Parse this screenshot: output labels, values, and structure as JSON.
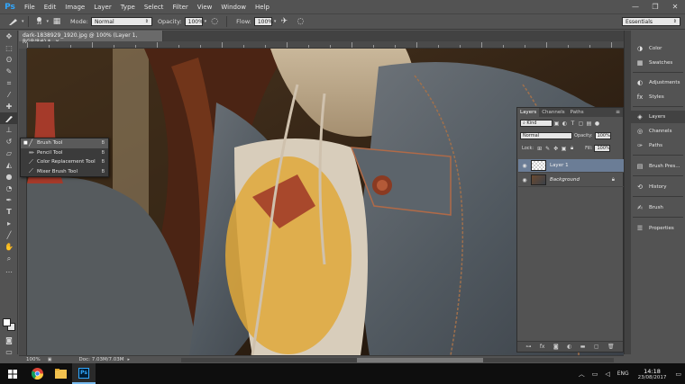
{
  "app": {
    "logo": "Ps",
    "menu": [
      "File",
      "Edit",
      "Image",
      "Layer",
      "Type",
      "Select",
      "Filter",
      "View",
      "Window",
      "Help"
    ]
  },
  "window_controls": [
    "—",
    "❐",
    "✕"
  ],
  "options_bar": {
    "brush_size": "30",
    "mode_label": "Mode:",
    "mode_value": "Normal",
    "opacity_label": "Opacity:",
    "opacity_value": "100%",
    "flow_label": "Flow:",
    "flow_value": "100%",
    "workspace": "Essentials"
  },
  "document": {
    "tab_title": "dark-1838929_1920.jpg @ 100% (Layer 1, RGB/8#) *",
    "zoom": "100%",
    "doc_size": "Doc: 7.03M/7.03M"
  },
  "tool_flyout": {
    "items": [
      {
        "label": "Brush Tool",
        "key": "B",
        "selected": true,
        "icon": "brush-icon"
      },
      {
        "label": "Pencil Tool",
        "key": "B",
        "selected": false,
        "icon": "pencil-icon"
      },
      {
        "label": "Color Replacement Tool",
        "key": "B",
        "selected": false,
        "icon": "color-replacement-icon"
      },
      {
        "label": "Mixer Brush Tool",
        "key": "B",
        "selected": false,
        "icon": "mixer-brush-icon"
      }
    ]
  },
  "layers_panel": {
    "tabs": [
      "Layers",
      "Channels",
      "Paths"
    ],
    "active_tab": "Layers",
    "kind_filter": "Kind",
    "blend_mode": "Normal",
    "opacity_label": "Opacity:",
    "opacity_value": "100%",
    "lock_label": "Lock:",
    "fill_label": "Fill:",
    "fill_value": "100%",
    "layers": [
      {
        "name": "Layer 1",
        "selected": true,
        "locked": false
      },
      {
        "name": "Background",
        "selected": false,
        "locked": true
      }
    ]
  },
  "dock": {
    "groups": [
      [
        "Color",
        "Swatches"
      ],
      [
        "Adjustments",
        "Styles"
      ],
      [
        "Layers",
        "Channels",
        "Paths"
      ],
      [
        "Brush Pres..."
      ],
      [
        "History"
      ],
      [
        "Brush"
      ],
      [
        "Properties"
      ]
    ]
  },
  "taskbar": {
    "language": "ENG",
    "time": "14:18",
    "date": "23/08/2017"
  }
}
